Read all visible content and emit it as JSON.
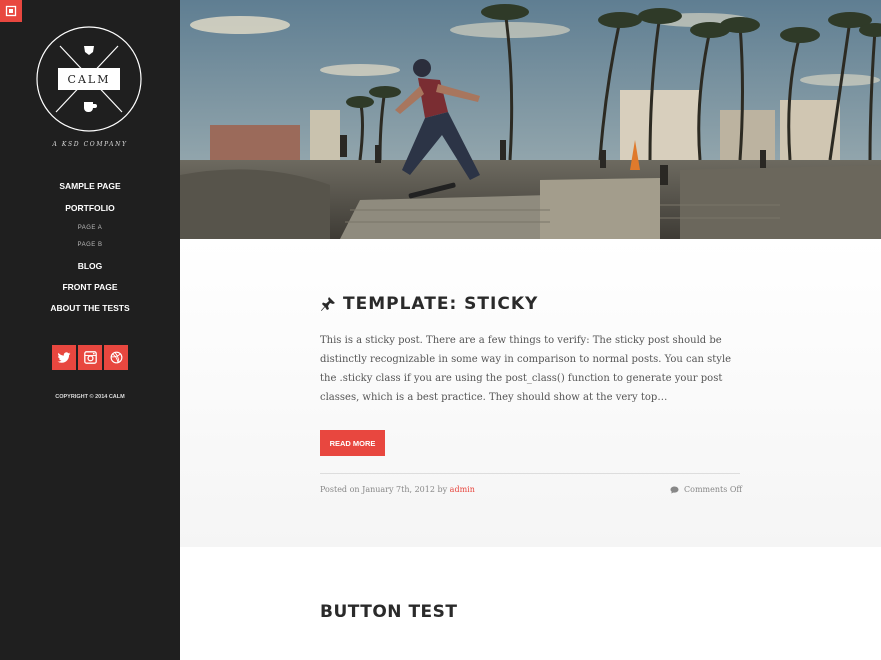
{
  "sidebar": {
    "logo_text": "CALM",
    "tagline": "A KSD COMPANY",
    "nav": [
      {
        "label": "SAMPLE PAGE"
      },
      {
        "label": "PORTFOLIO"
      },
      {
        "label": "PAGE A"
      },
      {
        "label": "PAGE B"
      },
      {
        "label": "BLOG"
      },
      {
        "label": "FRONT PAGE"
      },
      {
        "label": "ABOUT THE TESTS"
      }
    ],
    "social": [
      "twitter-icon",
      "instagram-icon",
      "dribbble-icon"
    ],
    "copyright": "COPYRIGHT © 2014 CALM"
  },
  "posts": [
    {
      "title": "TEMPLATE: STICKY",
      "excerpt": "This is a sticky post. There are a few things to verify: The sticky post should be distinctly recognizable in some way in comparison to normal posts. You can style the .sticky class if you are using the post_class() function to generate your post classes, which is a best practice. They should show at the very top…",
      "read_more": "READ MORE",
      "posted_on": "Posted on January 7th, 2012 by ",
      "author": "admin",
      "comments": "Comments Off"
    },
    {
      "title": "BUTTON TEST"
    }
  ],
  "colors": {
    "accent": "#e8473f",
    "sidebar_bg": "#1f1f1f"
  }
}
